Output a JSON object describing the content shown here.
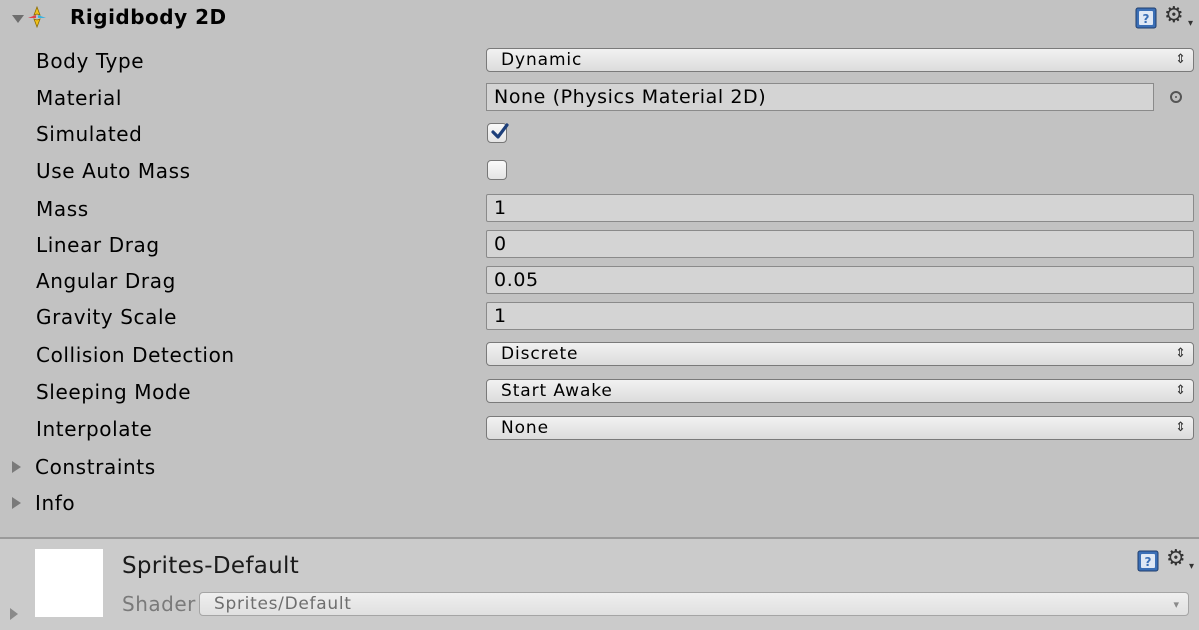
{
  "component": {
    "title": "Rigidbody 2D",
    "help_icon": "help-book-icon",
    "settings_icon": "gear-icon"
  },
  "fields": {
    "body_type": {
      "label": "Body Type",
      "value": "Dynamic"
    },
    "material": {
      "label": "Material",
      "value": "None (Physics Material 2D)"
    },
    "simulated": {
      "label": "Simulated",
      "checked": true
    },
    "use_auto_mass": {
      "label": "Use Auto Mass",
      "checked": false
    },
    "mass": {
      "label": "Mass",
      "value": "1"
    },
    "linear_drag": {
      "label": "Linear Drag",
      "value": "0"
    },
    "angular_drag": {
      "label": "Angular Drag",
      "value": "0.05"
    },
    "gravity_scale": {
      "label": "Gravity Scale",
      "value": "1"
    },
    "collision_detection": {
      "label": "Collision Detection",
      "value": "Discrete"
    },
    "sleeping_mode": {
      "label": "Sleeping Mode",
      "value": "Start Awake"
    },
    "interpolate": {
      "label": "Interpolate",
      "value": "None"
    }
  },
  "foldouts": {
    "constraints": "Constraints",
    "info": "Info"
  },
  "material_panel": {
    "name": "Sprites-Default",
    "shader_label": "Shader",
    "shader_value": "Sprites/Default"
  },
  "colors": {
    "inspector_bg": "#c2c2c2",
    "field_bg": "#d4d4d4",
    "accent_blue": "#3b6fb6",
    "icon_yellow": "#f2c21a"
  }
}
